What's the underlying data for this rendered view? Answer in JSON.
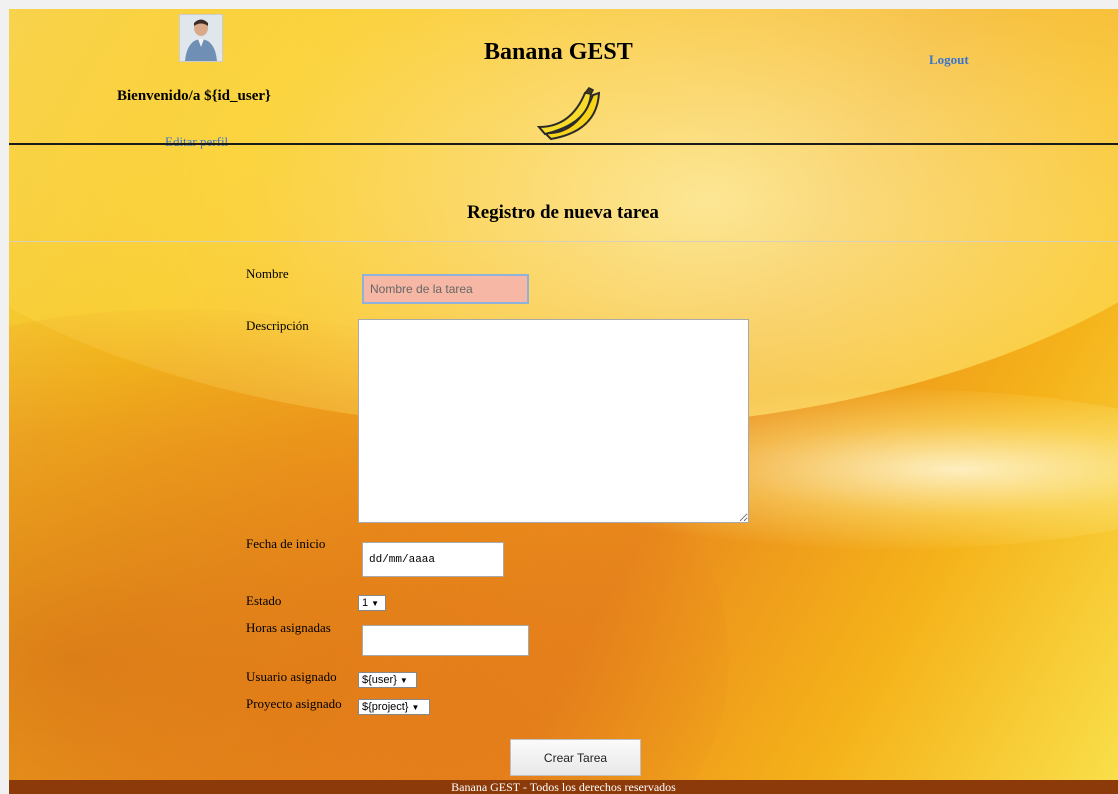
{
  "header": {
    "welcome": "Bienvenido/a ${id_user}",
    "edit_profile": "Editar perfil",
    "site_title": "Banana GEST",
    "logout": "Logout"
  },
  "form": {
    "title": "Registro de nueva tarea",
    "nombre": {
      "label": "Nombre",
      "placeholder": "Nombre de la tarea",
      "value": ""
    },
    "descripcion": {
      "label": "Descripción",
      "value": ""
    },
    "fecha": {
      "label": "Fecha de inicio",
      "value": "dd/mm/aaaa"
    },
    "estado": {
      "label": "Estado",
      "selected": "1"
    },
    "horas": {
      "label": "Horas asignadas",
      "value": ""
    },
    "usuario": {
      "label": "Usuario asignado",
      "selected": "${user}"
    },
    "proyecto": {
      "label": "Proyecto asignado",
      "selected": "${project}"
    },
    "submit": "Crear Tarea"
  },
  "footer": {
    "text": "Banana GEST - Todos los derechos reservados"
  },
  "icons": {
    "avatar": "user-avatar-photo",
    "logo": "banana-icon",
    "dropdown": "chevron-down-icon"
  },
  "colors": {
    "link": "#3a74d0",
    "footer_bg": "#8c3a09",
    "focused_input_bg": "#f6b8a5"
  }
}
